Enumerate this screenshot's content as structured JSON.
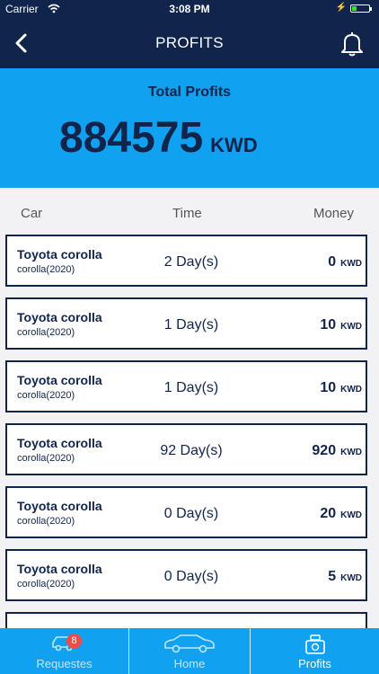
{
  "status_bar": {
    "carrier": "Carrier",
    "time": "3:08 PM",
    "battery_level": 0.3
  },
  "nav": {
    "title": "PROFITS"
  },
  "summary": {
    "title": "Total Profits",
    "amount": "884575",
    "unit": "KWD"
  },
  "columns": {
    "car": "Car",
    "time": "Time",
    "money": "Money"
  },
  "rows": [
    {
      "car": "Toyota corolla",
      "model": "corolla(2020)",
      "time": "2 Day(s)",
      "money": "0",
      "unit": "KWD"
    },
    {
      "car": "Toyota corolla",
      "model": "corolla(2020)",
      "time": "1 Day(s)",
      "money": "10",
      "unit": "KWD"
    },
    {
      "car": "Toyota corolla",
      "model": "corolla(2020)",
      "time": "1 Day(s)",
      "money": "10",
      "unit": "KWD"
    },
    {
      "car": "Toyota corolla",
      "model": "corolla(2020)",
      "time": "92 Day(s)",
      "money": "920",
      "unit": "KWD"
    },
    {
      "car": "Toyota corolla",
      "model": "corolla(2020)",
      "time": "0 Day(s)",
      "money": "20",
      "unit": "KWD"
    },
    {
      "car": "Toyota corolla",
      "model": "corolla(2020)",
      "time": "0 Day(s)",
      "money": "5",
      "unit": "KWD"
    }
  ],
  "tabs": [
    {
      "label": "Requestes",
      "icon": "car-request-icon",
      "badge": "8",
      "active": false
    },
    {
      "label": "Home",
      "icon": "car-icon",
      "active": false
    },
    {
      "label": "Profits",
      "icon": "money-icon",
      "active": true
    }
  ],
  "colors": {
    "navy": "#10244c",
    "accent": "#10a2f0",
    "badge": "#f04a4a"
  }
}
